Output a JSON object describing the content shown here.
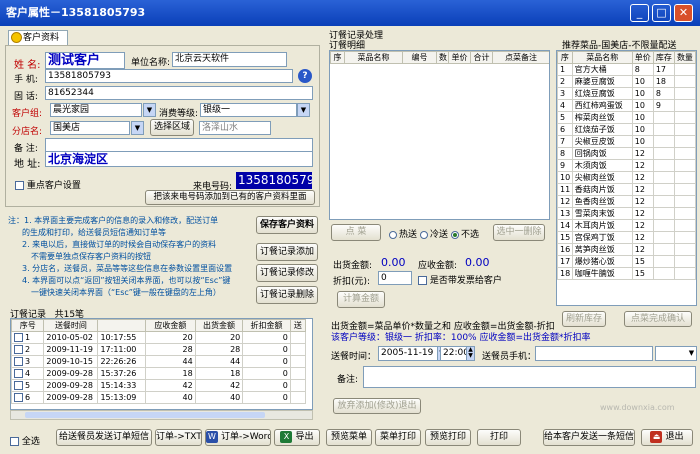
{
  "window": {
    "title": "客户属性－13581805793"
  },
  "tab": {
    "label": "客户资料"
  },
  "customer": {
    "name_label": "姓 名:",
    "name": "测试客户",
    "unit_label": "单位名称:",
    "unit": "北京云天软件",
    "mobile_label": "手 机:",
    "mobile": "13581805793",
    "phone_label": "固 话:",
    "phone": "81652344",
    "group_label": "客户组:",
    "group": "晨光家园",
    "level_label": "消费等级:",
    "level": "银级一",
    "branch_label": "分店名:",
    "branch": "国美店",
    "select_area": "选择区域",
    "area": "洛泽山水",
    "remark_label": "备 注:",
    "address_label": "地 址:",
    "address": "北京海淀区",
    "key_customer": "重点客户设置",
    "caller_label": "来电号码:",
    "caller": "13581805793",
    "add_caller_button": "把该来电号码添加到已有的客户资料里面"
  },
  "notes": [
    "注：1. 本界面主要完成客户的信息的录入和修改，配送订单",
    "的生成和打印，给送餐员短信通知订单等",
    "2. 来电以后，直接做订单的时候会自动保存客户的资料",
    "不需要单独点保存客户资料的按钮",
    "3. 分店名，送餐员，菜品等等这些信息在参数设置里面设置",
    "4. 本界面可以点“返回”按钮关闭本界面，也可以按“Esc”键",
    "一键快速关闭本界面（“Esc”键一般在键盘的左上角）"
  ],
  "side_buttons": {
    "save": "保存客户资料",
    "add": "订餐记录添加",
    "edit": "订餐记录修改",
    "delete": "订餐记录删除"
  },
  "history": {
    "title": "订餐记录",
    "count": "共15笔",
    "columns": [
      "序号",
      "送餐时间",
      "",
      "应收金额",
      "出货金额",
      "折扣金额",
      "送"
    ],
    "rows": [
      [
        "1",
        "2010-05-02",
        "10:17:55",
        "20",
        "20",
        "0"
      ],
      [
        "2",
        "2009-11-19",
        "17:11:00",
        "28",
        "28",
        "0"
      ],
      [
        "3",
        "2009-10-15",
        "22:26:26",
        "44",
        "44",
        "0"
      ],
      [
        "4",
        "2009-09-28",
        "15:37:26",
        "18",
        "18",
        "0"
      ],
      [
        "5",
        "2009-09-28",
        "15:14:33",
        "42",
        "42",
        "0"
      ],
      [
        "6",
        "2009-09-28",
        "15:13:09",
        "40",
        "40",
        "0"
      ]
    ]
  },
  "order": {
    "section_title": "订餐记录处理",
    "detail_title": "订餐明细",
    "columns": [
      "序",
      "菜品名称",
      "编号",
      "数",
      "单价",
      "合计",
      "点菜备注"
    ],
    "order_button": "点 菜",
    "radios": [
      "热送",
      "冷送",
      "不选"
    ],
    "radio_selected": 2,
    "select_one": "选中一删除",
    "ship_label": "出货金额:",
    "ship_value": "0.00",
    "receivable_label": "应收金额:",
    "receivable_value": "0.00",
    "discount_label": "折扣(元):",
    "discount_value": "0",
    "invoice": "是否带发票给客户",
    "calc_button": "计算金额",
    "formula": "出货金额=菜品单价*数量之和   应收金额=出货金额-折扣",
    "level_note": "该客户等级：银级一     折扣率：100%    应收金额=出货金额*折扣率",
    "time_label": "送餐时间：",
    "date": "2005-11-19",
    "time": "22:00",
    "deliverer_label": "送餐员手机：",
    "remark_label": "备注:",
    "cancel_button": "放弃添加(修改)退出"
  },
  "recommend": {
    "title": "推荐菜品-国美店-不限量配送",
    "columns": [
      "序",
      "菜品名称",
      "单价",
      "库存",
      "数量"
    ],
    "rows": [
      [
        "1",
        "官方大桶",
        "8",
        "17",
        ""
      ],
      [
        "2",
        "麻婆豆腐饭",
        "10",
        "18",
        ""
      ],
      [
        "3",
        "红烧豆腐饭",
        "10",
        "8",
        ""
      ],
      [
        "4",
        "西红柿鸡蛋饭",
        "10",
        "9",
        ""
      ],
      [
        "5",
        "榨菜肉丝饭",
        "10",
        "",
        ""
      ],
      [
        "6",
        "红烧茄子饭",
        "10",
        "",
        ""
      ],
      [
        "7",
        "尖椒豆皮饭",
        "10",
        "",
        ""
      ],
      [
        "8",
        "回锅肉饭",
        "12",
        "",
        ""
      ],
      [
        "9",
        "木须肉饭",
        "12",
        "",
        ""
      ],
      [
        "10",
        "尖椒肉丝饭",
        "12",
        "",
        ""
      ],
      [
        "11",
        "香菇肉片饭",
        "12",
        "",
        ""
      ],
      [
        "12",
        "鱼香肉丝饭",
        "12",
        "",
        ""
      ],
      [
        "13",
        "雪菜肉末饭",
        "12",
        "",
        ""
      ],
      [
        "14",
        "木耳肉片饭",
        "12",
        "",
        ""
      ],
      [
        "15",
        "宫保鸡丁饭",
        "12",
        "",
        ""
      ],
      [
        "16",
        "莴笋肉丝饭",
        "12",
        "",
        ""
      ],
      [
        "17",
        "爆炒猪心饭",
        "15",
        "",
        ""
      ],
      [
        "18",
        "咖喱牛腩饭",
        "15",
        "",
        ""
      ]
    ],
    "refresh_button": "刷新库存",
    "confirm_button": "点菜完成确认"
  },
  "bottom": {
    "select_all": "全选",
    "send_sms": "给送餐员发送订单短信",
    "txt": "订单->TXT",
    "word": "订单->Word",
    "export": "导出",
    "preview_menu": "预览菜单",
    "print_menu": "菜单打印",
    "preview_print": "预览打印",
    "print": "打印",
    "sms_customer": "给本客户发送一条短信",
    "exit": "退出"
  },
  "watermark": "www.downxia.com"
}
